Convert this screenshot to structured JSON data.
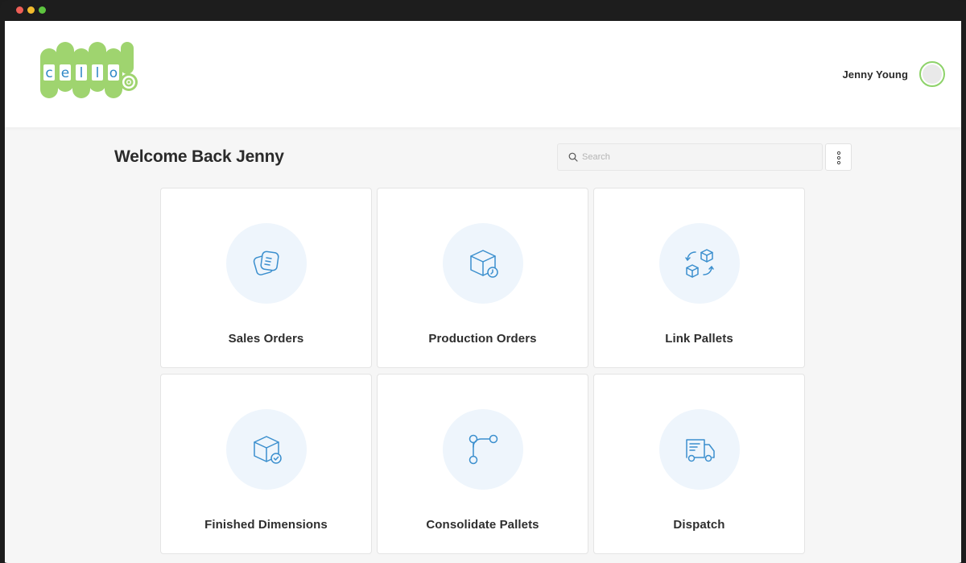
{
  "header": {
    "logo_letters": [
      "c",
      "e",
      "l",
      "l",
      "o"
    ],
    "user_name": "Jenny Young"
  },
  "main": {
    "welcome": "Welcome Back Jenny",
    "search": {
      "placeholder": "Search",
      "value": ""
    }
  },
  "tiles": [
    {
      "label": "Sales Orders",
      "icon": "documents-icon"
    },
    {
      "label": "Production Orders",
      "icon": "box-clock-icon"
    },
    {
      "label": "Link Pallets",
      "icon": "boxes-exchange-icon"
    },
    {
      "label": "Finished Dimensions",
      "icon": "box-check-icon"
    },
    {
      "label": "Consolidate Pallets",
      "icon": "git-merge-icon"
    },
    {
      "label": "Dispatch",
      "icon": "truck-icon"
    }
  ],
  "colors": {
    "brand_green": "#9fd46f",
    "brand_blue": "#2e87c6",
    "icon_blue": "#3b8fce",
    "icon_circle_bg": "#eef5fc",
    "page_bg": "#f6f6f6"
  }
}
